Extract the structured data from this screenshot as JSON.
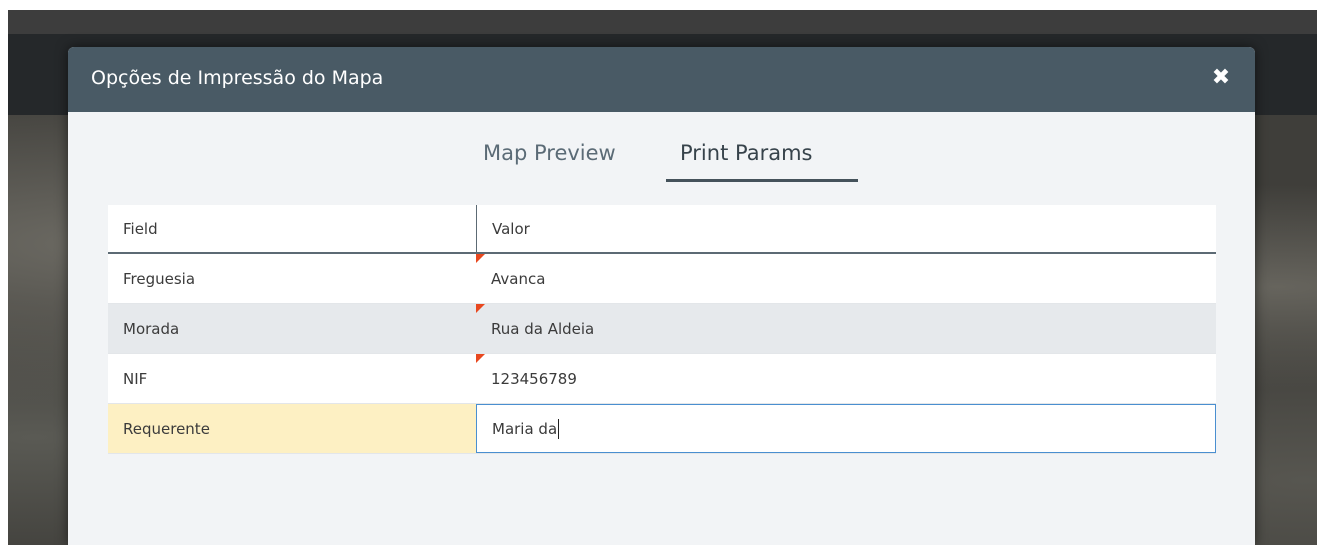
{
  "modal": {
    "title": "Opções de Impressão do Mapa",
    "close_icon": "close-icon"
  },
  "tabs": [
    {
      "label": "Map Preview",
      "active": false
    },
    {
      "label": "Print Params",
      "active": true
    }
  ],
  "grid": {
    "columns": [
      "Field",
      "Valor"
    ],
    "rows": [
      {
        "field": "Freguesia",
        "value": "Avanca",
        "dirty": true
      },
      {
        "field": "Morada",
        "value": "Rua da Aldeia",
        "dirty": true
      },
      {
        "field": "NIF",
        "value": "123456789",
        "dirty": true
      },
      {
        "field": "Requerente",
        "value": "Maria da",
        "dirty": false,
        "editing": true
      }
    ]
  },
  "colors": {
    "modal_header": "#495a65",
    "dirty_marker": "#e8481f",
    "active_field_highlight": "#fdf0c3",
    "editor_border": "#4a8fd0"
  }
}
